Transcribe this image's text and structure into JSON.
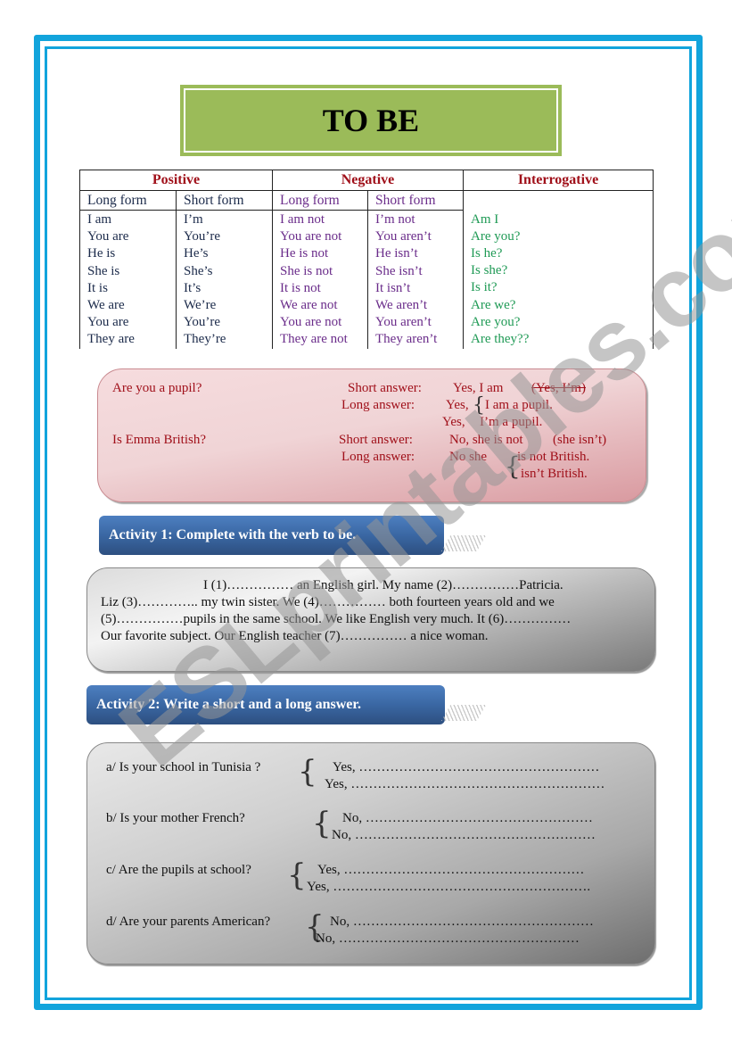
{
  "title": "TO BE",
  "table": {
    "headers": {
      "positive": "Positive",
      "negative": "Negative",
      "interrogative": "Interrogative"
    },
    "subheaders": {
      "pos_long": "Long form",
      "pos_short": "Short form",
      "neg_long": "Long form",
      "neg_short": "Short form"
    },
    "pos_long": [
      "I am",
      "You are",
      "He is",
      "She is",
      "It is",
      "We are",
      "You are",
      "They are"
    ],
    "pos_short": [
      "I’m",
      "You’re",
      "He’s",
      "She’s",
      "It’s",
      "We’re",
      "You’re",
      "They’re"
    ],
    "neg_long": [
      "I am not",
      "You are not",
      "He is not",
      "She is not",
      "It is not",
      "We are not",
      "You are not",
      "They are not"
    ],
    "neg_short": [
      "I’m not",
      "You aren’t",
      "He isn’t",
      "She isn’t",
      "It isn’t",
      "We aren’t",
      "You aren’t",
      "They aren’t"
    ],
    "interrogative": [
      "Am I",
      "Are you?",
      "Is he?",
      "Is she?",
      "Is it?",
      "Are we?",
      "Are you?",
      "Are they??"
    ]
  },
  "examples": {
    "q1": "Are you a pupil?",
    "q1_short_label": "Short answer:",
    "q1_short_value": "Yes, I am",
    "q1_short_struck": "(Yes, I’m)",
    "q1_long_label": "Long answer:",
    "q1_long_a": "Yes,",
    "q1_long_a_rest": "I am a pupil.",
    "q1_long_b": "Yes,",
    "q1_long_b_rest": "I’m a pupil.",
    "q2": "Is Emma British?",
    "q2_short_label": "Short answer:",
    "q2_short_value": "No, she is not",
    "q2_short_alt": "(she isn’t)",
    "q2_long_label": "Long answer:",
    "q2_long_prefix": "No  she",
    "q2_long_a": "is not British.",
    "q2_long_b": "isn’t British."
  },
  "activity1": {
    "header": "Activity 1: Complete with the verb to be.",
    "lines": [
      "I (1)…………… an English girl. My name (2)……………Patricia.",
      "Liz (3)………….. my twin sister. We (4)……………  both fourteen years old and we",
      "(5)……………pupils in the same school. We like English very much. It (6)……………",
      "Our favorite subject. Our English teacher (7)…………… a nice woman."
    ]
  },
  "activity2": {
    "header": "Activity 2: Write a short and a long answer.",
    "items": [
      {
        "question": "a/ Is your school in Tunisia ?",
        "short": "Yes, ………………………………………………",
        "long": "Yes, …………………………………………………"
      },
      {
        "question": "b/ Is your mother French?",
        "short": "No, ……………………………………………",
        "long": "No, ………………………………………………"
      },
      {
        "question": "c/ Are the pupils at school?",
        "short": "Yes, ………………………………………………",
        "long": "Yes, …………………………………………………."
      },
      {
        "question": "d/ Are your parents American?",
        "short": "No, ………………………………………………",
        "long": "No, ………………………………………………"
      }
    ]
  },
  "watermark": "ESLprintables.com",
  "colors": {
    "frame": "#12a4dc",
    "title_bg": "#9bbb59",
    "header_red": "#a0101a",
    "positive": "#1b2a4a",
    "negative": "#6a2c8a",
    "interrogative": "#1f9a55",
    "activity_header": "#3a67a3"
  }
}
